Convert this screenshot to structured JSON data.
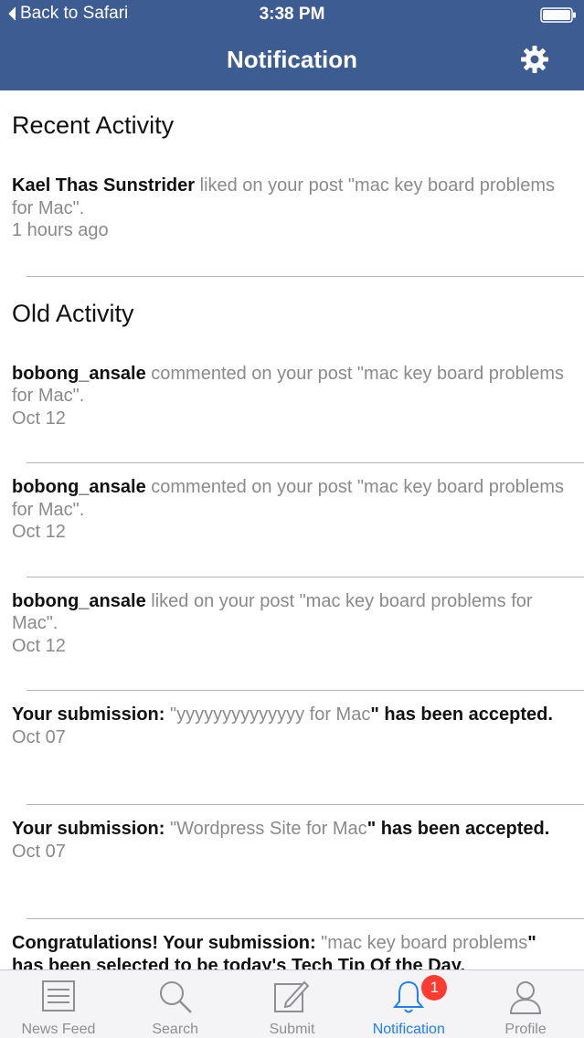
{
  "status_bar": {
    "back_label": "Back to Safari",
    "time": "3:38 PM"
  },
  "nav": {
    "title": "Notification",
    "settings_icon": "gear-icon"
  },
  "colors": {
    "header_bg": "#3d5d92",
    "accent": "#1e7ff0",
    "badge": "#fe3b30"
  },
  "sections": {
    "recent_title": "Recent Activity",
    "old_title": "Old Activity"
  },
  "recent": [
    {
      "actor": "Kael Thas Sunstrider",
      "text": " liked on your post \"mac key board problems for Mac\".",
      "date": "1 hours ago"
    }
  ],
  "old": [
    {
      "actor": "bobong_ansale",
      "text": " commented on your post \"mac key board problems for Mac\".",
      "date": "Oct 12"
    },
    {
      "actor": "bobong_ansale",
      "text": " commented on your post \"mac key board problems for Mac\".",
      "date": "Oct 12"
    },
    {
      "actor": "bobong_ansale",
      "text": " liked on your post \"mac key board problems for Mac\".",
      "date": "Oct 12"
    }
  ],
  "submissions": [
    {
      "prefix": "Your submission: ",
      "quote_open": "\"",
      "title": "yyyyyyyyyyyyyy for Mac",
      "quote_close": "\"",
      "suffix": " has been accepted.",
      "date": "Oct 07"
    },
    {
      "prefix": "Your submission: ",
      "quote_open": "\"",
      "title": "Wordpress Site for Mac",
      "quote_close": "\"",
      "suffix": " has been accepted.",
      "date": "Oct 07"
    }
  ],
  "tip": {
    "prefix": "Congratulations! Your submission: ",
    "quote_open": "\"",
    "title": "mac key board problems",
    "quote_close": "\"",
    "suffix": " has been selected to be today's Tech Tip Of the Day."
  },
  "tabbar": {
    "tabs": [
      {
        "label": "News Feed",
        "icon": "news-feed-icon"
      },
      {
        "label": "Search",
        "icon": "search-icon"
      },
      {
        "label": "Submit",
        "icon": "submit-icon"
      },
      {
        "label": "Notification",
        "icon": "bell-icon",
        "badge": "1"
      },
      {
        "label": "Profile",
        "icon": "profile-icon"
      }
    ]
  }
}
